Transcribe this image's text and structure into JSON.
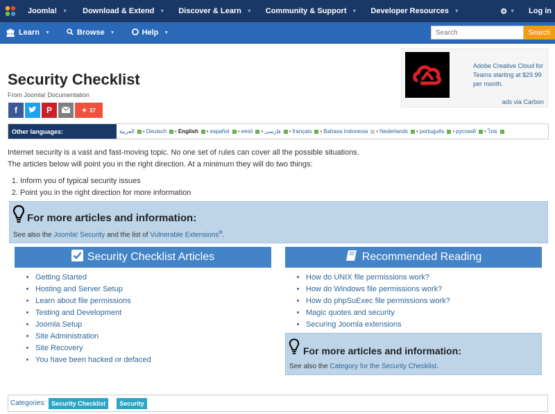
{
  "colors": {
    "topbar": "#1a3867",
    "subbar": "#2a69b8",
    "accent": "#f39c12",
    "section_header": "#4383c7",
    "infobox": "#bed4e8",
    "tag": "#2ba5c4"
  },
  "topnav": {
    "items": [
      "Joomla!",
      "Download & Extend",
      "Discover & Learn",
      "Community & Support",
      "Developer Resources"
    ],
    "login": "Log in",
    "settings_icon": "cogs-icon"
  },
  "subnav": {
    "items": [
      {
        "label": "Learn",
        "icon": "university-icon"
      },
      {
        "label": "Browse",
        "icon": "search-icon"
      },
      {
        "label": "Help",
        "icon": "life-ring-icon"
      }
    ],
    "search_placeholder": "Search",
    "search_button": "Search"
  },
  "ad": {
    "text": "Adobe Creative Cloud for Teams starting at $29.99 per month.",
    "via": "ads via Carbon",
    "image_icon": "creative-cloud-icon"
  },
  "page": {
    "title": "Security Checklist",
    "from": "From Joomla! Documentation",
    "share_count": "37"
  },
  "languages": {
    "label": "Other languages:",
    "items": [
      {
        "name": "العربية",
        "current": false,
        "square": true
      },
      {
        "name": "Deutsch",
        "current": false,
        "square": true
      },
      {
        "name": "English",
        "current": true,
        "square": true
      },
      {
        "name": "español",
        "current": false,
        "square": true
      },
      {
        "name": "eesti",
        "current": false,
        "square": true
      },
      {
        "name": "فارسی",
        "current": false,
        "square": true
      },
      {
        "name": "français",
        "current": false,
        "square": true
      },
      {
        "name": "Bahasa Indonesia",
        "current": false,
        "square": false
      },
      {
        "name": "Nederlands",
        "current": false,
        "square": true
      },
      {
        "name": "português",
        "current": false,
        "square": true
      },
      {
        "name": "русский",
        "current": false,
        "square": true
      },
      {
        "name": "ไทย",
        "current": false,
        "square": true
      }
    ]
  },
  "intro": {
    "line1": "Internet security is a vast and fast-moving topic. No one set of rules can cover all the possible situations.",
    "line2": "The articles below will point you in the right direction. At a minimum they will do two things:",
    "steps": [
      "Inform you of typical security issues",
      "Point you in the right direction for more information"
    ]
  },
  "infobox1": {
    "heading": "For more articles and information:",
    "prefix": "See also the ",
    "link1": "Joomla! Security",
    "middle": " and the list of ",
    "link2": "Vulnerable Extensions",
    "suffix": "."
  },
  "left_column": {
    "heading": "Security Checklist Articles",
    "icon": "check-square-icon",
    "links": [
      "Getting Started",
      "Hosting and Server Setup",
      "Learn about file permissions",
      "Testing and Development",
      "Joomla Setup",
      "Site Administration",
      "Site Recovery",
      "You have been hacked or defaced"
    ]
  },
  "right_column": {
    "heading": "Recommended Reading",
    "icon": "book-icon",
    "links": [
      "How do UNIX file permissions work?",
      "How do Windows file permissions work?",
      "How do phpSuExec file permissions work?",
      "Magic quotes and security",
      "Securing Joomla extensions"
    ]
  },
  "infobox2": {
    "heading": "For more articles and information:",
    "prefix": "See also the ",
    "link": "Category for the Security Checklist",
    "suffix": "."
  },
  "categories": {
    "label": "Categories:",
    "tags": [
      "Security Checklist",
      "Security"
    ]
  }
}
